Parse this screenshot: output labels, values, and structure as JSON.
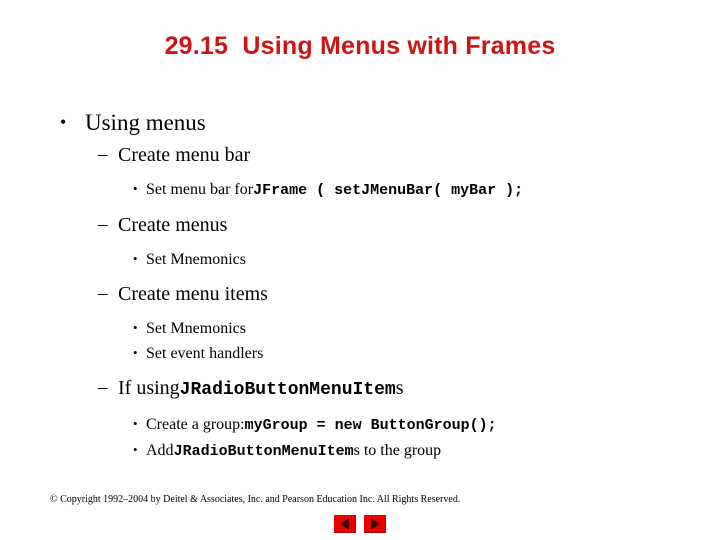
{
  "slide": {
    "title": "29.15  Using Menus with Frames",
    "title_color": "#cc1414",
    "background_color": "#ffffff"
  },
  "outline": {
    "l1_using_menus": "Using menus",
    "l2_create_menu_bar": "Create menu bar",
    "l3_set_menu_bar_prefix": "Set menu bar for ",
    "l3_set_menu_bar_code": "JFrame ( setJMenuBar( myBar );",
    "l2_create_menus": "Create menus",
    "l3_set_mnemonics_1": "Set Mnemonics",
    "l2_create_menu_items": "Create menu items",
    "l3_set_mnemonics_2": "Set Mnemonics",
    "l3_set_event_handlers": "Set event handlers",
    "l2_if_using_prefix": "If using ",
    "l2_if_using_code": "JRadioButtonMenuItem",
    "l2_if_using_suffix": "s",
    "l3_create_group_prefix": "Create a group: ",
    "l3_create_group_code": "myGroup = new ButtonGroup();",
    "l3_add_prefix": "Add ",
    "l3_add_code": "JRadioButtonMenuItem",
    "l3_add_suffix": "s to the group"
  },
  "bullets": {
    "level1_marker": "•",
    "level2_marker": "–",
    "level3_marker": "•"
  },
  "footer": {
    "copyright": "© Copyright 1992–2004 by Deitel & Associates, Inc. and Pearson Education Inc. All Rights Reserved."
  },
  "navigation": {
    "previous_icon": "left-triangle-icon",
    "next_icon": "right-triangle-icon",
    "button_color": "#ee0000"
  }
}
